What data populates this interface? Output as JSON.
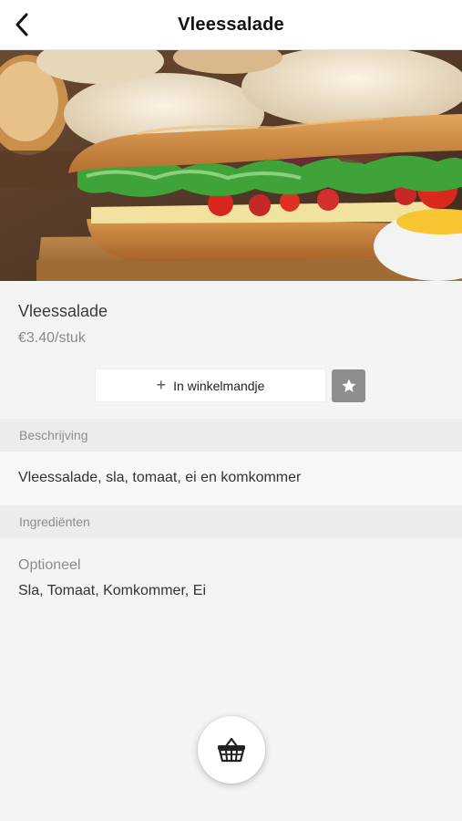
{
  "header": {
    "title": "Vleessalade",
    "back_icon": "chevron-left-icon"
  },
  "hero": {
    "image_description_icon": "sandwich-photo"
  },
  "product": {
    "name": "Vleessalade",
    "price": "€3.40/stuk",
    "add_to_cart_label": "In winkelmandje",
    "add_icon": "plus-icon",
    "favorite_icon": "star-icon"
  },
  "sections": {
    "description_header": "Beschrijving",
    "description_text": "Vleessalade, sla, tomaat, ei en komkommer",
    "ingredients_header": "Ingrediënten",
    "optional_label": "Optioneel",
    "optional_items": "Sla, Tomaat, Komkommer, Ei"
  },
  "floating": {
    "basket_icon": "basket-icon"
  },
  "colors": {
    "background": "#f4f4f4",
    "section_header_bg": "#ececec",
    "favorite_bg": "#8e8e8e",
    "text_primary": "#333333",
    "text_muted": "#8d8d8d"
  }
}
